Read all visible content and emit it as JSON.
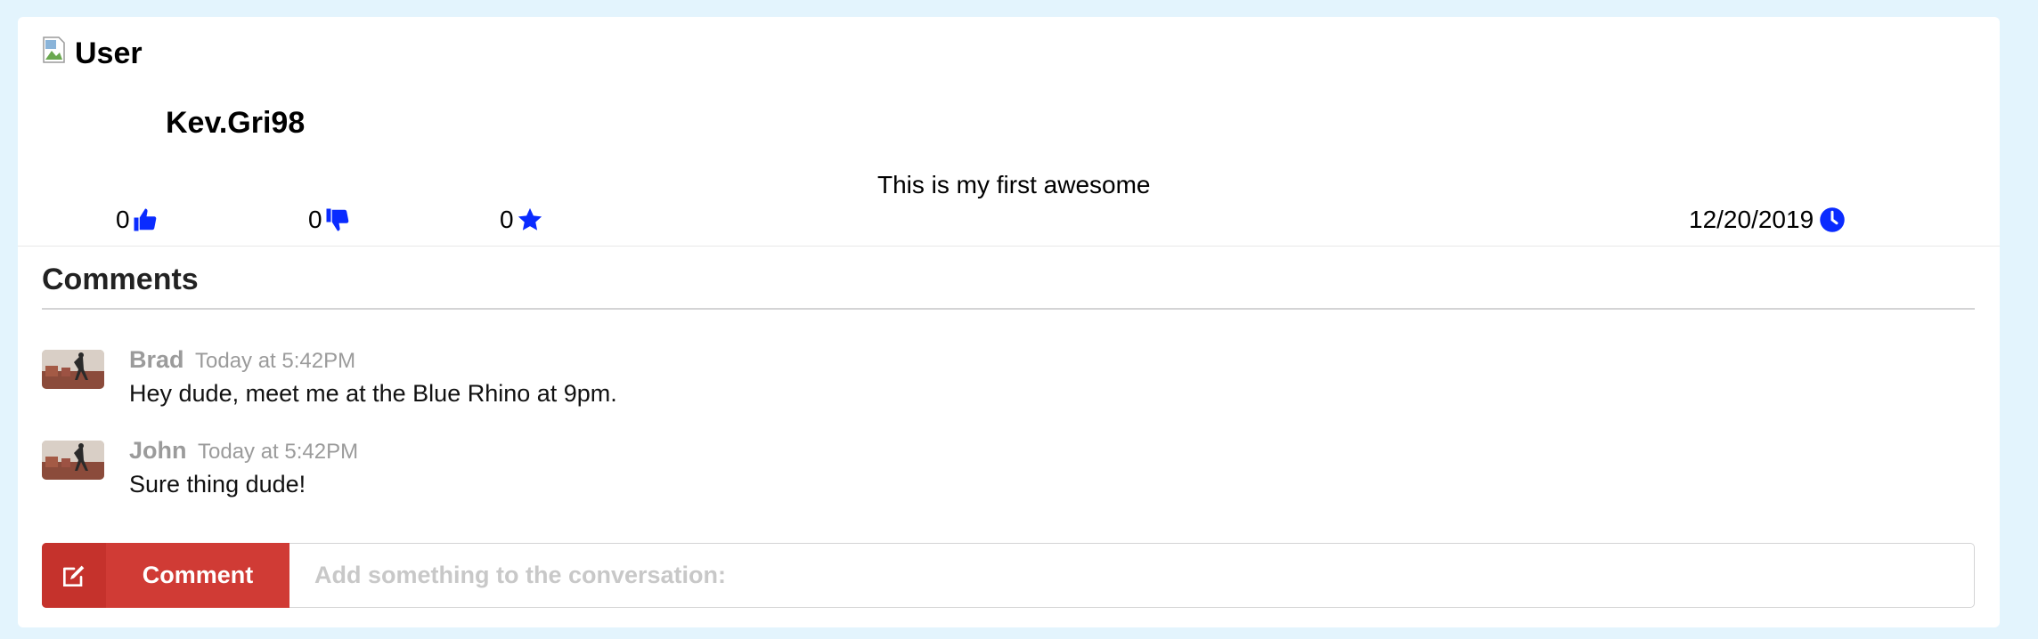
{
  "post": {
    "image_alt": "User",
    "username": "Kev.Gri98",
    "text": "This is my first awesome",
    "likes": "0",
    "dislikes": "0",
    "favorites": "0",
    "date": "12/20/2019",
    "icons": {
      "likes": "thumbs-up-icon",
      "dislikes": "thumbs-down-icon",
      "favorites": "star-icon",
      "date": "clock-icon"
    }
  },
  "comments_section": {
    "title": "Comments",
    "items": [
      {
        "author": "Brad",
        "time": "Today at 5:42PM",
        "text": "Hey dude, meet me at the Blue Rhino at 9pm."
      },
      {
        "author": "John",
        "time": "Today at 5:42PM",
        "text": "Sure thing dude!"
      }
    ]
  },
  "reply": {
    "button_label": "Comment",
    "button_icon": "edit-icon",
    "placeholder": "Add something to the conversation:",
    "value": ""
  },
  "colors": {
    "page_bg": "#e3f4fd",
    "icon_blue": "#0a2bff",
    "button_red": "#d03b35",
    "meta_gray": "#9b9b9b"
  }
}
